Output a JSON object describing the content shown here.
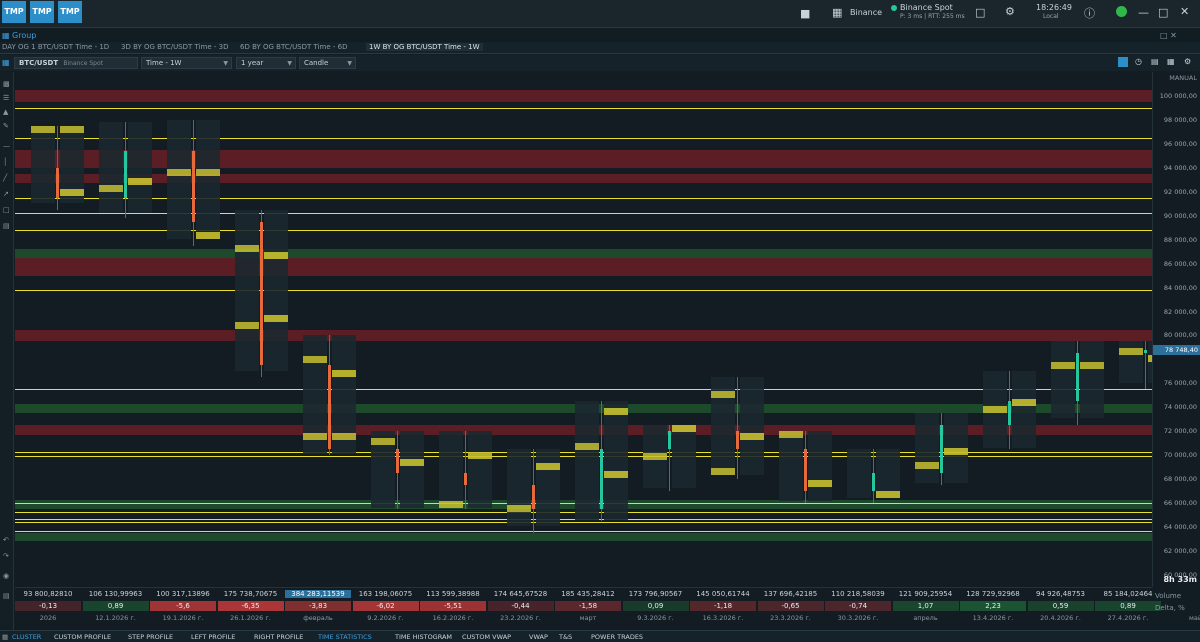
{
  "header": {
    "tmp_buttons": [
      "TMP",
      "TMP",
      "TMP"
    ],
    "exchange": "Binance",
    "spot_label": "Binance Spot",
    "ping": "P: 3 ms | RTT: 255 ms",
    "time": "18:26:49",
    "timezone": "Local"
  },
  "group_label": "Group",
  "tabs": [
    "DAY OG 1 BTC/USDT Time - 1D",
    "3D BY OG BTC/USDT Time - 3D",
    "6D BY OG BTC/USDT Time - 6D",
    "1W BY OG BTC/USDT Time - 1W"
  ],
  "toolbar": {
    "symbol": "BTC/USDT",
    "symbol_exchange": "Binance Spot",
    "timeframe": "Time - 1W",
    "range": "1 year",
    "chart_type": "Candle"
  },
  "price_axis": {
    "mode": "MANUAL",
    "labels": [
      "100 000,00",
      "98 000,00",
      "96 000,00",
      "94 000,00",
      "92 000,00",
      "90 000,00",
      "88 000,00",
      "86 000,00",
      "84 000,00",
      "82 000,00",
      "80 000,00",
      "78 748,40",
      "76 000,00",
      "74 000,00",
      "72 000,00",
      "70 000,00",
      "68 000,00",
      "66 000,00",
      "64 000,00",
      "62 000,00",
      "60 000,00"
    ],
    "current": "78 748,40",
    "timer": "8h 33m"
  },
  "volume_row": [
    "93 800,82810",
    "106 130,99963",
    "100 317,13896",
    "175 738,70675",
    "384 283,11539",
    "163 198,06075",
    "113 599,38988",
    "174 645,67528",
    "185 435,28412",
    "173 796,90567",
    "145 050,61744",
    "137 696,42185",
    "110 218,58039",
    "121 909,25954",
    "128 729,92968",
    "94 926,48753",
    "85 184,02464"
  ],
  "delta_row": [
    "-0,13",
    "0,89",
    "-5,6",
    "-6,35",
    "-3,83",
    "-6,02",
    "-5,51",
    "-0,44",
    "-1,58",
    "0,09",
    "-1,18",
    "-0,65",
    "-0,74",
    "1,07",
    "2,23",
    "0,59",
    "0,89"
  ],
  "date_row": [
    "2026",
    "12.1.2026 г.",
    "19.1.2026 г.",
    "26.1.2026 г.",
    "февраль",
    "9.2.2026 г.",
    "16.2.2026 г.",
    "23.2.2026 г.",
    "март",
    "9.3.2026 г.",
    "16.3.2026 г.",
    "23.3.2026 г.",
    "30.3.2026 г.",
    "апрель",
    "13.4.2026 г.",
    "20.4.2026 г.",
    "27.4.2026 г.",
    "май"
  ],
  "row_labels": [
    "Volume",
    "Delta, %"
  ],
  "bottom_tabs": [
    "CLUSTER",
    "CUSTOM PROFILE",
    "STEP PROFILE",
    "LEFT PROFILE",
    "RIGHT PROFILE",
    "TIME STATISTICS",
    "TIME HISTOGRAM",
    "CUSTOM VWAP",
    "VWAP",
    "T&S",
    "POWER TRADES"
  ],
  "colors": {
    "accent": "#2c8fc9",
    "up": "#26c6a0",
    "down": "#e86a3a",
    "level": "#e8e030"
  },
  "chart_data": {
    "type": "cluster-candle",
    "candles": [
      {
        "x": "2026",
        "open": 94000,
        "high": 97500,
        "low": 90500,
        "close": 91500
      },
      {
        "x": "12.1.2026 г.",
        "open": 91500,
        "high": 97800,
        "low": 89800,
        "close": 95400
      },
      {
        "x": "19.1.2026 г.",
        "open": 95400,
        "high": 98000,
        "low": 87500,
        "close": 89500
      },
      {
        "x": "26.1.2026 г.",
        "open": 89500,
        "high": 90500,
        "low": 76500,
        "close": 77500
      },
      {
        "x": "февраль",
        "open": 77500,
        "high": 80000,
        "low": 70000,
        "close": 70500
      },
      {
        "x": "9.2.2026 г.",
        "open": 70500,
        "high": 72000,
        "low": 65500,
        "close": 68500
      },
      {
        "x": "16.2.2026 г.",
        "open": 68500,
        "high": 72000,
        "low": 65500,
        "close": 67500
      },
      {
        "x": "23.2.2026 г.",
        "open": 67500,
        "high": 70500,
        "low": 63500,
        "close": 65500
      },
      {
        "x": "март",
        "open": 65500,
        "high": 74500,
        "low": 64500,
        "close": 70500
      },
      {
        "x": "9.3.2026 г.",
        "open": 70500,
        "high": 72500,
        "low": 67000,
        "close": 72000
      },
      {
        "x": "16.3.2026 г.",
        "open": 72000,
        "high": 76500,
        "low": 68000,
        "close": 70500
      },
      {
        "x": "23.3.2026 г.",
        "open": 70500,
        "high": 72000,
        "low": 66000,
        "close": 67000
      },
      {
        "x": "30.3.2026 г.",
        "open": 67000,
        "high": 70500,
        "low": 66000,
        "close": 68500
      },
      {
        "x": "апрель",
        "open": 68500,
        "high": 73500,
        "low": 67500,
        "close": 72500
      },
      {
        "x": "13.4.2026 г.",
        "open": 72500,
        "high": 77000,
        "low": 70500,
        "close": 74500
      },
      {
        "x": "20.4.2026 г.",
        "open": 74500,
        "high": 79500,
        "low": 72500,
        "close": 78500
      },
      {
        "x": "27.4.2026 г.",
        "open": 78500,
        "high": 79500,
        "low": 75500,
        "close": 78748
      }
    ],
    "ylim": [
      59000,
      102000
    ],
    "levels": [
      99000,
      96500,
      91500,
      90200,
      88800,
      83800,
      75500,
      70300,
      69900,
      66000,
      65300,
      64700,
      64400,
      63700
    ],
    "zones": [
      {
        "from": 99500,
        "to": 100500,
        "color": "#5a1e24"
      },
      {
        "from": 94000,
        "to": 95500,
        "color": "#5a1e24"
      },
      {
        "from": 92700,
        "to": 93500,
        "color": "#5a1e24"
      },
      {
        "from": 85000,
        "to": 86500,
        "color": "#5a1e24"
      },
      {
        "from": 79500,
        "to": 80500,
        "color": "#5a1e24"
      },
      {
        "from": 86500,
        "to": 87200,
        "color": "#1d4a2a"
      },
      {
        "from": 73500,
        "to": 74300,
        "color": "#1d4a2a"
      },
      {
        "from": 71700,
        "to": 72500,
        "color": "#5a1e24"
      },
      {
        "from": 65500,
        "to": 66300,
        "color": "#1d4a2a"
      },
      {
        "from": 62800,
        "to": 63500,
        "color": "#1d4a2a"
      }
    ]
  }
}
